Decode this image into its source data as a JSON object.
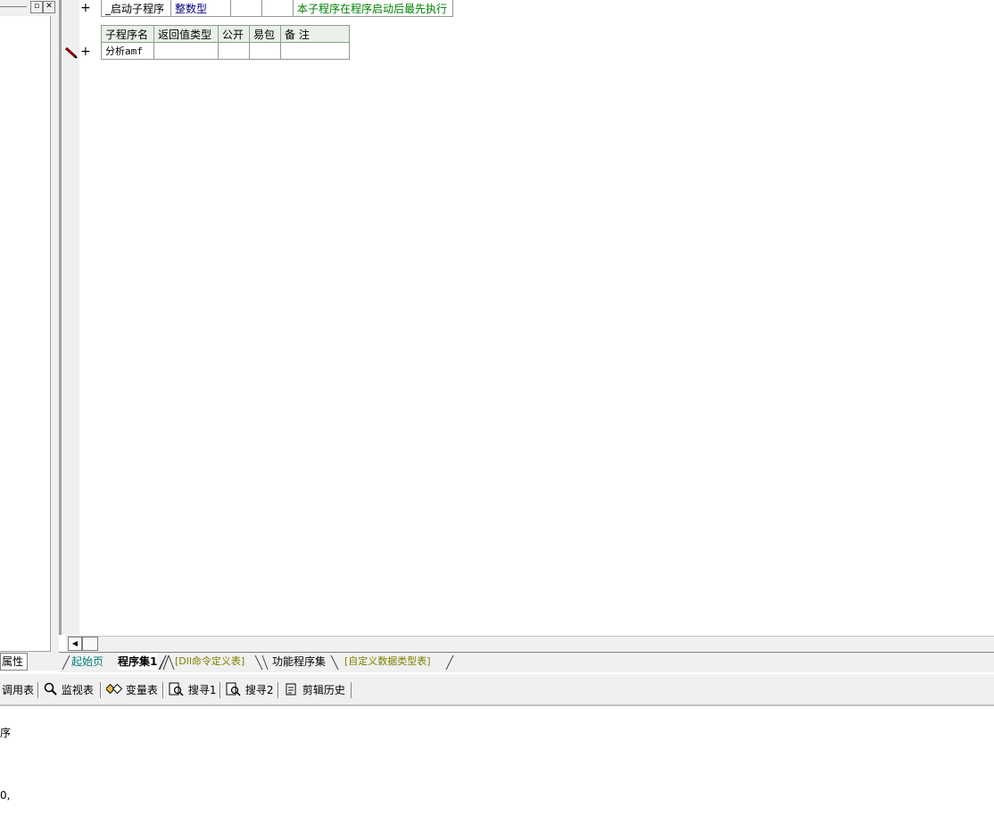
{
  "left_panel": {
    "restore_glyph": "▫",
    "close_glyph": "✕",
    "props_tab_label": "属性"
  },
  "editor": {
    "row1": {
      "plus": "+",
      "name": "_启动子程序",
      "return_type": "整数型",
      "public": "",
      "easy_pack": "",
      "remark": "本子程序在程序启动后最先执行"
    },
    "sub_table": {
      "headers": [
        "子程序名",
        "返回值类型",
        "公开",
        "易包",
        "备 注"
      ],
      "plus": "+",
      "name_value": "分析amf",
      "return_type": "",
      "public": "",
      "easy_pack": "",
      "remark": ""
    }
  },
  "scroll": {
    "left_arrow": "◀"
  },
  "tabs": [
    {
      "label": "起始页",
      "color": "#008080",
      "bold": false
    },
    {
      "label": "程序集1",
      "color": "#000000",
      "bold": true
    },
    {
      "label": "[Dll命令定义表]",
      "color": "#808000",
      "bold": false
    },
    {
      "label": "功能程序集",
      "color": "#000000",
      "bold": false
    },
    {
      "label": "[自定义数据类型表]",
      "color": "#808000",
      "bold": false
    }
  ],
  "toolbar": {
    "items": [
      {
        "label": "调用表",
        "icon": ""
      },
      {
        "label": "监视表",
        "icon": "magnifier-icon"
      },
      {
        "label": "变量表",
        "icon": "variables-icon"
      },
      {
        "label": "搜寻1",
        "icon": "search-doc-icon"
      },
      {
        "label": "搜寻2",
        "icon": "search-doc-icon"
      },
      {
        "label": "剪辑历史",
        "icon": "clipboard-icon"
      }
    ]
  },
  "output": {
    "line1": "序",
    "line2": "0,"
  }
}
